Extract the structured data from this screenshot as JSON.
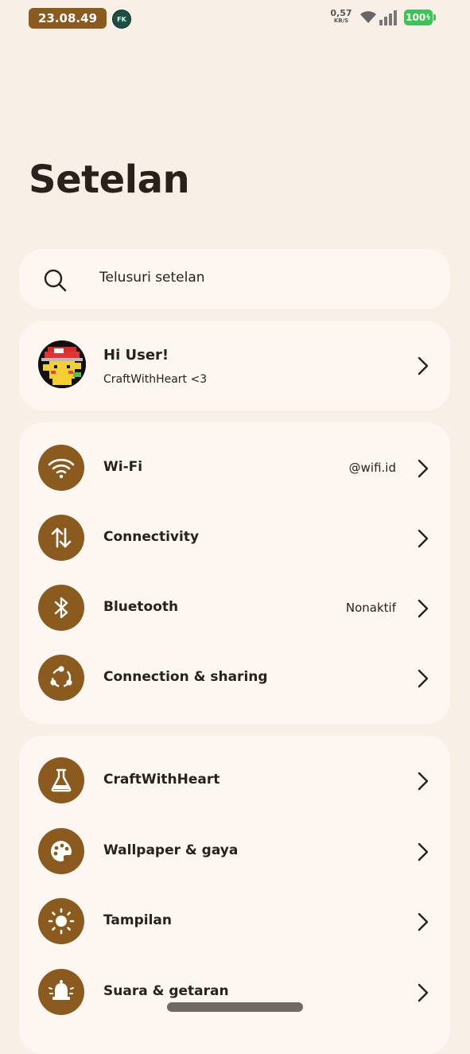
{
  "status_bar": {
    "time": "23.08.49",
    "app_badge": "FK",
    "net_speed_value": "0,57",
    "net_speed_unit": "KB/S",
    "battery": "100"
  },
  "page": {
    "title": "Setelan"
  },
  "search": {
    "placeholder": "Telusuri setelan"
  },
  "profile": {
    "greeting": "Hi User!",
    "subtitle": "CraftWithHeart <3"
  },
  "groups": [
    {
      "items": [
        {
          "label": "Wi-Fi",
          "value": "@wifi.id",
          "icon": "wifi-icon"
        },
        {
          "label": "Connectivity",
          "value": "",
          "icon": "arrows-updown-icon"
        },
        {
          "label": "Bluetooth",
          "value": "Nonaktif",
          "icon": "bluetooth-icon"
        },
        {
          "label": "Connection & sharing",
          "value": "",
          "icon": "share-icon"
        }
      ]
    },
    {
      "items": [
        {
          "label": "CraftWithHeart",
          "value": "",
          "icon": "flask-icon"
        },
        {
          "label": "Wallpaper & gaya",
          "value": "",
          "icon": "palette-icon"
        },
        {
          "label": "Tampilan",
          "value": "",
          "icon": "sun-icon"
        },
        {
          "label": "Suara & getaran",
          "value": "",
          "icon": "bell-icon"
        }
      ]
    }
  ],
  "colors": {
    "accent": "#8a5a1f",
    "background": "#f8efe7",
    "card": "#fdf6f1",
    "battery": "#3cc454"
  }
}
